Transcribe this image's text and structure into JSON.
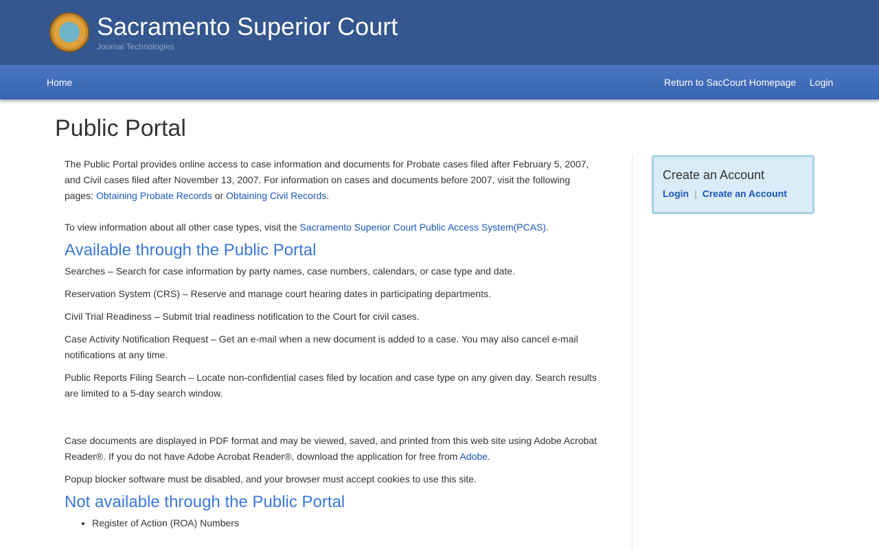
{
  "header": {
    "title": "Sacramento Superior Court",
    "subtitle": "Journal Technologies"
  },
  "nav": {
    "home": "Home",
    "return": "Return to SacCourt Homepage",
    "login": "Login"
  },
  "page_title": "Public Portal",
  "intro": {
    "p1": "The Public Portal provides online access to case information and documents for Probate cases filed after February 5, 2007, and Civil cases filed after November 13, 2007. For information on cases and documents before 2007, visit the following pages: ",
    "link1": "Obtaining Probate Records",
    "or": " or ",
    "link2": "Obtaining Civil Records",
    "end": ".",
    "p2": "To view information about all other case types, visit the ",
    "link3": "Sacramento Superior Court Public Access System(PCAS)",
    "p2end": "."
  },
  "available": {
    "heading": "Available through the Public Portal",
    "items": [
      "Searches – Search for case information by party names, case numbers, calendars, or case type and date.",
      "Reservation System (CRS) – Reserve and manage court hearing dates in participating departments.",
      "Civil Trial Readiness – Submit trial readiness notification to the Court for civil cases.",
      "Case Activity Notification Request – Get an e-mail when a new document is added to a case. You may also cancel e-mail notifications at any time.",
      "Public Reports Filing Search – Locate non-confidential cases filed by location and case type on any given day. Search results are limited to a 5-day search window."
    ]
  },
  "docs": {
    "p1": "Case documents are displayed in PDF format and may be viewed, saved, and printed from this web site using Adobe Acrobat Reader®. If you do not have Adobe Acrobat Reader®, download the application for free from ",
    "adobe": "Adobe",
    "end": ".",
    "p2": "Popup blocker software must be disabled, and your browser must accept cookies to use this site."
  },
  "not_available": {
    "heading": "Not available through the Public Portal",
    "items": [
      "Register of Action (ROA) Numbers"
    ]
  },
  "sidebar": {
    "title": "Create an Account",
    "login": "Login",
    "sep": "|",
    "create": "Create an Account"
  }
}
